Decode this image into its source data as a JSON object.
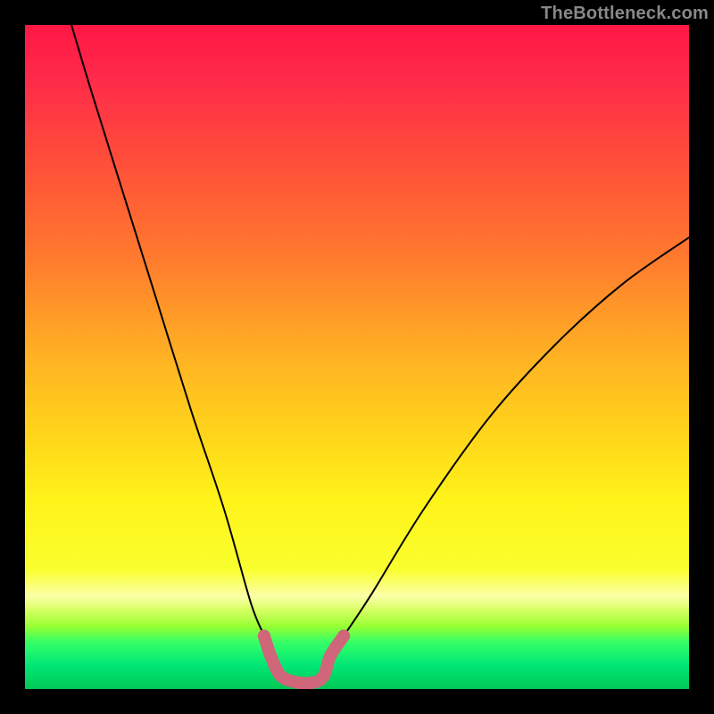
{
  "watermark": "TheBottleneck.com",
  "chart_data": {
    "type": "line",
    "title": "",
    "xlabel": "",
    "ylabel": "",
    "xlim": [
      0,
      100
    ],
    "ylim": [
      0,
      100
    ],
    "grid": false,
    "series": [
      {
        "name": "bottleneck-curve",
        "description": "V-shaped bottleneck percentage curve with flat valley; values read off gradient position",
        "x": [
          7,
          10,
          15,
          20,
          25,
          30,
          34,
          36,
          37,
          38.5,
          41,
          43.5,
          45,
          46,
          48,
          52,
          60,
          70,
          80,
          90,
          100
        ],
        "values": [
          100,
          90,
          74,
          58,
          42,
          27,
          13,
          8,
          5,
          2,
          1,
          1,
          2,
          5,
          8,
          14,
          27,
          41,
          52,
          61,
          68
        ]
      },
      {
        "name": "optimal-range-curve",
        "description": "Thick pink segment marking the flat valley + entry tails",
        "x": [
          36,
          37,
          38.5,
          41,
          43.5,
          45,
          46,
          48
        ],
        "values": [
          8,
          5,
          2,
          1,
          1,
          2,
          5,
          8
        ]
      }
    ],
    "background_gradient_stops": [
      {
        "pos": 0.0,
        "color": "#ff1744"
      },
      {
        "pos": 0.08,
        "color": "#ff2a4a"
      },
      {
        "pos": 0.2,
        "color": "#ff4d3a"
      },
      {
        "pos": 0.35,
        "color": "#ff7a2e"
      },
      {
        "pos": 0.5,
        "color": "#ffb223"
      },
      {
        "pos": 0.62,
        "color": "#ffd61a"
      },
      {
        "pos": 0.72,
        "color": "#fff41a"
      },
      {
        "pos": 0.82,
        "color": "#f9ff2e"
      },
      {
        "pos": 0.86,
        "color": "#fcffa8"
      },
      {
        "pos": 0.88,
        "color": "#d9ff66"
      },
      {
        "pos": 0.905,
        "color": "#99ff33"
      },
      {
        "pos": 0.93,
        "color": "#33ff66"
      },
      {
        "pos": 0.965,
        "color": "#00e676"
      },
      {
        "pos": 1.0,
        "color": "#00c853"
      }
    ],
    "curve_color": "#000000",
    "optimal_color": "#cf6679"
  }
}
